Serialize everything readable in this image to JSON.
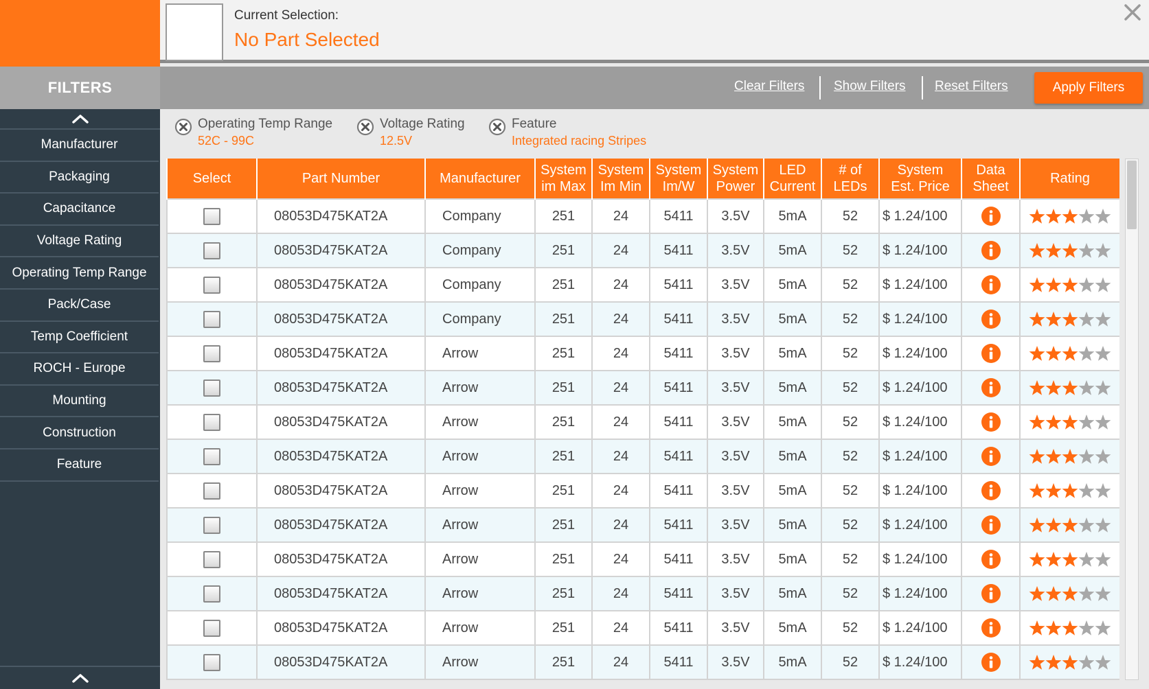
{
  "header": {
    "current_selection_label": "Current Selection:",
    "current_selection_value": "No Part Selected"
  },
  "filters_bar": {
    "title": "FILTERS",
    "clear_filters": "Clear Filters",
    "show_filters": "Show Filters",
    "reset_filters": "Reset Filters",
    "apply_filters": "Apply Filters"
  },
  "sidebar": {
    "items": [
      {
        "label": "Manufacturer"
      },
      {
        "label": "Packaging"
      },
      {
        "label": "Capacitance"
      },
      {
        "label": "Voltage Rating"
      },
      {
        "label": "Operating Temp Range"
      },
      {
        "label": "Pack/Case"
      },
      {
        "label": "Temp Coefficient"
      },
      {
        "label": "ROCH - Europe"
      },
      {
        "label": "Mounting"
      },
      {
        "label": "Construction"
      },
      {
        "label": "Feature"
      }
    ]
  },
  "active_filters": [
    {
      "label": "Operating Temp Range",
      "value": "52C - 99C"
    },
    {
      "label": "Voltage Rating",
      "value": "12.5V"
    },
    {
      "label": "Feature",
      "value": "Integrated racing Stripes"
    }
  ],
  "table": {
    "columns": [
      {
        "line1": "Select",
        "line2": ""
      },
      {
        "line1": "Part Number",
        "line2": ""
      },
      {
        "line1": "Manufacturer",
        "line2": ""
      },
      {
        "line1": "System",
        "line2": "im Max"
      },
      {
        "line1": "System",
        "line2": "Im Min"
      },
      {
        "line1": "System",
        "line2": "Im/W"
      },
      {
        "line1": "System",
        "line2": "Power"
      },
      {
        "line1": "LED",
        "line2": "Current"
      },
      {
        "line1": "# of",
        "line2": "LEDs"
      },
      {
        "line1": "System",
        "line2": "Est. Price"
      },
      {
        "line1": "Data",
        "line2": "Sheet"
      },
      {
        "line1": "Rating",
        "line2": ""
      }
    ],
    "rows": [
      {
        "part": "08053D475KAT2A",
        "manufacturer": "Company",
        "im_max": "251",
        "im_min": "24",
        "im_w": "5411",
        "power": "3.5V",
        "current": "5mA",
        "leds": "52",
        "price": "$ 1.24/100",
        "rating": 3
      },
      {
        "part": "08053D475KAT2A",
        "manufacturer": "Company",
        "im_max": "251",
        "im_min": "24",
        "im_w": "5411",
        "power": "3.5V",
        "current": "5mA",
        "leds": "52",
        "price": "$ 1.24/100",
        "rating": 3
      },
      {
        "part": "08053D475KAT2A",
        "manufacturer": "Company",
        "im_max": "251",
        "im_min": "24",
        "im_w": "5411",
        "power": "3.5V",
        "current": "5mA",
        "leds": "52",
        "price": "$ 1.24/100",
        "rating": 3
      },
      {
        "part": "08053D475KAT2A",
        "manufacturer": "Company",
        "im_max": "251",
        "im_min": "24",
        "im_w": "5411",
        "power": "3.5V",
        "current": "5mA",
        "leds": "52",
        "price": "$ 1.24/100",
        "rating": 3
      },
      {
        "part": "08053D475KAT2A",
        "manufacturer": "Arrow",
        "im_max": "251",
        "im_min": "24",
        "im_w": "5411",
        "power": "3.5V",
        "current": "5mA",
        "leds": "52",
        "price": "$ 1.24/100",
        "rating": 3
      },
      {
        "part": "08053D475KAT2A",
        "manufacturer": "Arrow",
        "im_max": "251",
        "im_min": "24",
        "im_w": "5411",
        "power": "3.5V",
        "current": "5mA",
        "leds": "52",
        "price": "$ 1.24/100",
        "rating": 3
      },
      {
        "part": "08053D475KAT2A",
        "manufacturer": "Arrow",
        "im_max": "251",
        "im_min": "24",
        "im_w": "5411",
        "power": "3.5V",
        "current": "5mA",
        "leds": "52",
        "price": "$ 1.24/100",
        "rating": 3
      },
      {
        "part": "08053D475KAT2A",
        "manufacturer": "Arrow",
        "im_max": "251",
        "im_min": "24",
        "im_w": "5411",
        "power": "3.5V",
        "current": "5mA",
        "leds": "52",
        "price": "$ 1.24/100",
        "rating": 3
      },
      {
        "part": "08053D475KAT2A",
        "manufacturer": "Arrow",
        "im_max": "251",
        "im_min": "24",
        "im_w": "5411",
        "power": "3.5V",
        "current": "5mA",
        "leds": "52",
        "price": "$ 1.24/100",
        "rating": 3
      },
      {
        "part": "08053D475KAT2A",
        "manufacturer": "Arrow",
        "im_max": "251",
        "im_min": "24",
        "im_w": "5411",
        "power": "3.5V",
        "current": "5mA",
        "leds": "52",
        "price": "$ 1.24/100",
        "rating": 3
      },
      {
        "part": "08053D475KAT2A",
        "manufacturer": "Arrow",
        "im_max": "251",
        "im_min": "24",
        "im_w": "5411",
        "power": "3.5V",
        "current": "5mA",
        "leds": "52",
        "price": "$ 1.24/100",
        "rating": 3
      },
      {
        "part": "08053D475KAT2A",
        "manufacturer": "Arrow",
        "im_max": "251",
        "im_min": "24",
        "im_w": "5411",
        "power": "3.5V",
        "current": "5mA",
        "leds": "52",
        "price": "$ 1.24/100",
        "rating": 3
      },
      {
        "part": "08053D475KAT2A",
        "manufacturer": "Arrow",
        "im_max": "251",
        "im_min": "24",
        "im_w": "5411",
        "power": "3.5V",
        "current": "5mA",
        "leds": "52",
        "price": "$ 1.24/100",
        "rating": 3
      },
      {
        "part": "08053D475KAT2A",
        "manufacturer": "Arrow",
        "im_max": "251",
        "im_min": "24",
        "im_w": "5411",
        "power": "3.5V",
        "current": "5mA",
        "leds": "52",
        "price": "$ 1.24/100",
        "rating": 3
      }
    ],
    "rating_max": 5
  },
  "icons": {
    "close": "close-icon",
    "chevron_up": "chevron-up-icon",
    "remove_filter": "remove-filter-icon",
    "info": "info-icon",
    "star": "star-icon"
  },
  "colors": {
    "accent": "#ff7516",
    "sidebar_bg": "#2f3d47",
    "star_filled": "#ff6a10",
    "star_empty": "#a8a8a8",
    "row_alt": "#eef8fb"
  }
}
